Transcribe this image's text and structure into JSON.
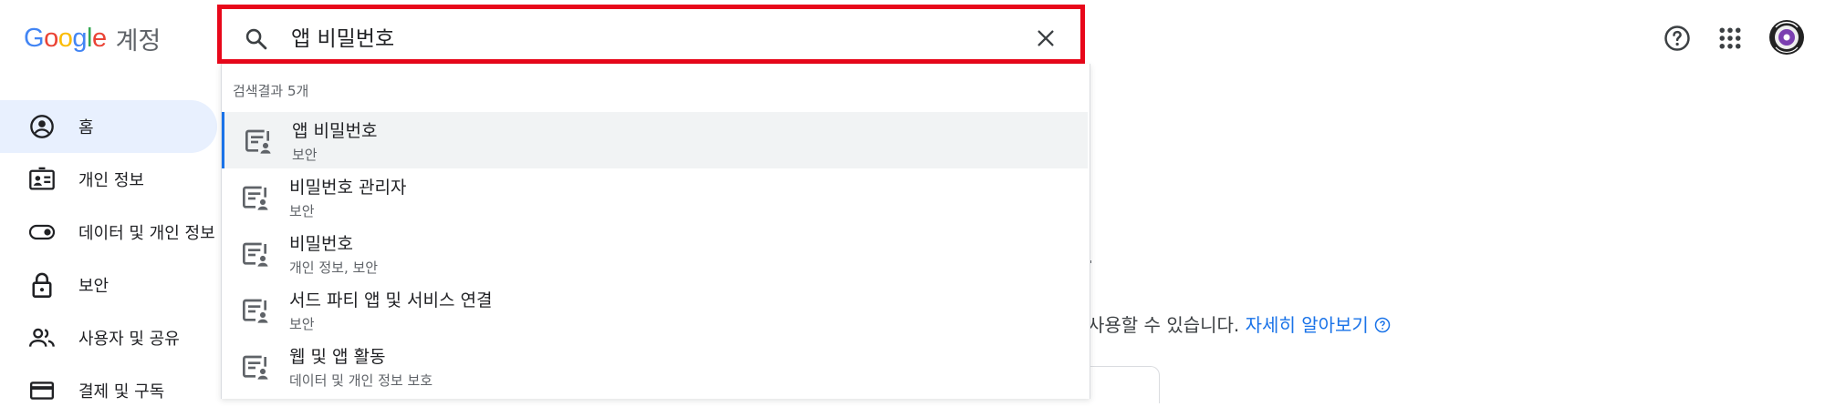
{
  "header": {
    "logo_letters": [
      "G",
      "o",
      "o",
      "g",
      "l",
      "e"
    ],
    "product": "계정",
    "search": {
      "value": "앱 비밀번호",
      "placeholder": ""
    }
  },
  "sidebar": {
    "items": [
      {
        "label": "홈",
        "icon": "account-circle-icon",
        "active": true
      },
      {
        "label": "개인 정보",
        "icon": "id-card-icon",
        "active": false
      },
      {
        "label": "데이터 및 개인 정보",
        "icon": "toggle-icon",
        "active": false
      },
      {
        "label": "보안",
        "icon": "lock-icon",
        "active": false
      },
      {
        "label": "사용자 및 공유",
        "icon": "people-icon",
        "active": false
      },
      {
        "label": "결제 및 구독",
        "icon": "credit-card-icon",
        "active": false
      }
    ]
  },
  "dropdown": {
    "count_label": "검색결과 5개",
    "results": [
      {
        "title": "앱 비밀번호",
        "subtitle": "보안"
      },
      {
        "title": "비밀번호 관리자",
        "subtitle": "보안"
      },
      {
        "title": "비밀번호",
        "subtitle": "개인 정보, 보안"
      },
      {
        "title": "서드 파티 앱 및 서비스 연결",
        "subtitle": "보안"
      },
      {
        "title": "웹 및 앱 활동",
        "subtitle": "데이터 및 개인 정보 보호"
      }
    ]
  },
  "main": {
    "partial_text": "사용할 수 있습니다.",
    "learn_more": "자세히 알아보기"
  },
  "colors": {
    "highlight_border": "#e8071a",
    "accent": "#1a73e8",
    "active_nav_bg": "#e8f0fe"
  }
}
